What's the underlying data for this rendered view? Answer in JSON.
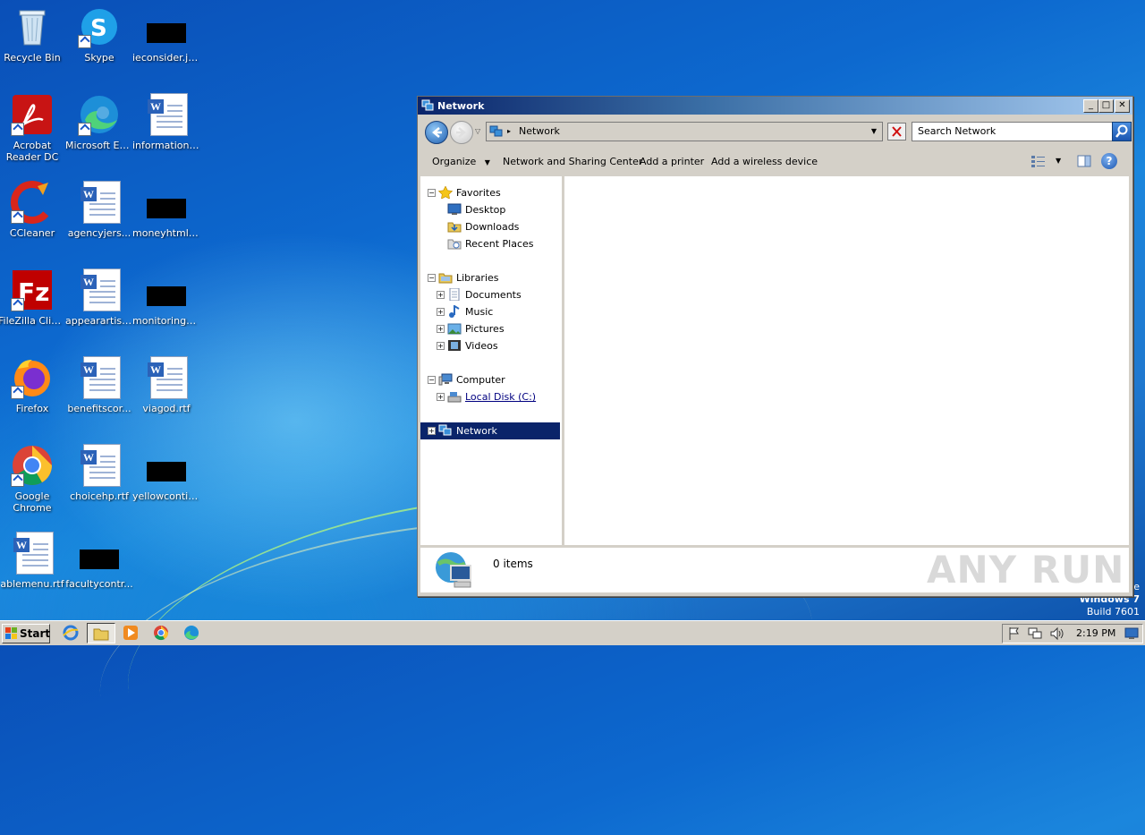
{
  "desktop": {
    "icons": [
      {
        "label": "Recycle Bin"
      },
      {
        "label": "Skype"
      },
      {
        "label": "ieconsider.jpg"
      },
      {
        "label": "Acrobat Reader DC"
      },
      {
        "label": "Microsoft Edge"
      },
      {
        "label": "information...."
      },
      {
        "label": "CCleaner"
      },
      {
        "label": "agencyjers..."
      },
      {
        "label": "moneyhtml.jpg"
      },
      {
        "label": "FileZilla Client"
      },
      {
        "label": "appearartist..."
      },
      {
        "label": "monitorings...."
      },
      {
        "label": "Firefox"
      },
      {
        "label": "benefitscor..."
      },
      {
        "label": "viagod.rtf"
      },
      {
        "label": "Google Chrome"
      },
      {
        "label": "choicehp.rtf"
      },
      {
        "label": "yellowcontin..."
      },
      {
        "label": "ablemenu.rtf"
      },
      {
        "label": "facultycontr..."
      }
    ],
    "os_text": {
      "line0": "le",
      "line1": "Windows 7",
      "line2": "Build 7601"
    },
    "watermark": "ANY RUN"
  },
  "window": {
    "title": "Network",
    "address": "Network",
    "search_placeholder": "Search Network",
    "toolbar": {
      "organize": "Organize",
      "sharing": "Network and Sharing Center",
      "printer": "Add a printer",
      "wireless": "Add a wireless device"
    },
    "nav": {
      "favorites": "Favorites",
      "desktop": "Desktop",
      "downloads": "Downloads",
      "recent": "Recent Places",
      "libraries": "Libraries",
      "documents": "Documents",
      "music": "Music",
      "pictures": "Pictures",
      "videos": "Videos",
      "computer": "Computer",
      "localdisk": "Local Disk (C:)",
      "network": "Network"
    },
    "status": "0 items"
  },
  "taskbar": {
    "start": "Start",
    "time": "2:19 PM"
  },
  "colors": {
    "selection": "#0a246a",
    "title_start": "#0a246a",
    "title_end": "#a6caf0"
  }
}
